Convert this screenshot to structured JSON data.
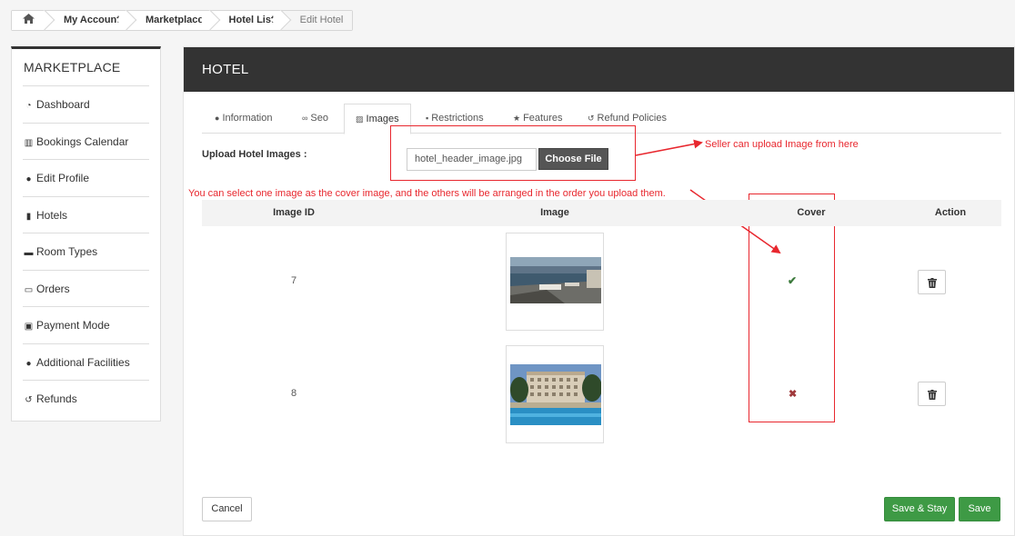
{
  "breadcrumb": {
    "home_icon": "home-icon",
    "items": [
      "My Account",
      "Marketplace",
      "Hotel List",
      "Edit Hotel"
    ]
  },
  "sidebar": {
    "title": "MARKETPLACE",
    "items": [
      {
        "label": "Dashboard",
        "icon": "dashboard-icon"
      },
      {
        "label": "Bookings Calendar",
        "icon": "bar-chart-icon"
      },
      {
        "label": "Edit Profile",
        "icon": "user-icon"
      },
      {
        "label": "Hotels",
        "icon": "building-icon"
      },
      {
        "label": "Room Types",
        "icon": "bed-icon"
      },
      {
        "label": "Orders",
        "icon": "credit-card-icon"
      },
      {
        "label": "Payment Mode",
        "icon": "money-icon"
      },
      {
        "label": "Additional Facilities",
        "icon": "user-plus-icon"
      },
      {
        "label": "Refunds",
        "icon": "undo-icon"
      }
    ]
  },
  "panel": {
    "title": "HOTEL",
    "tabs": [
      {
        "label": "Information",
        "icon": "info-icon"
      },
      {
        "label": "Seo",
        "icon": "link-icon"
      },
      {
        "label": "Images",
        "icon": "image-icon",
        "active": true
      },
      {
        "label": "Restrictions",
        "icon": "lock-icon"
      },
      {
        "label": "Features",
        "icon": "star-icon"
      },
      {
        "label": "Refund Policies",
        "icon": "undo-icon"
      }
    ],
    "upload": {
      "label": "Upload Hotel Images :",
      "file_name": "hotel_header_image.jpg",
      "choose_button": "Choose File"
    },
    "annotations": {
      "upload_hint": "Seller can upload Image from here",
      "cover_hint": "You can select one image as the cover image, and the others will be arranged in the order you upload them."
    },
    "table": {
      "headers": [
        "Image ID",
        "Image",
        "Cover",
        "Action"
      ],
      "rows": [
        {
          "id": "7",
          "cover": true,
          "image": "resort-terrace-sea-view"
        },
        {
          "id": "8",
          "cover": false,
          "image": "hotel-building-pool"
        }
      ]
    },
    "buttons": {
      "cancel": "Cancel",
      "save_stay": "Save & Stay",
      "save": "Save"
    },
    "colors": {
      "header_bg": "#333333",
      "annotation_red": "#e8272e",
      "save_green": "#3e9a45"
    }
  }
}
